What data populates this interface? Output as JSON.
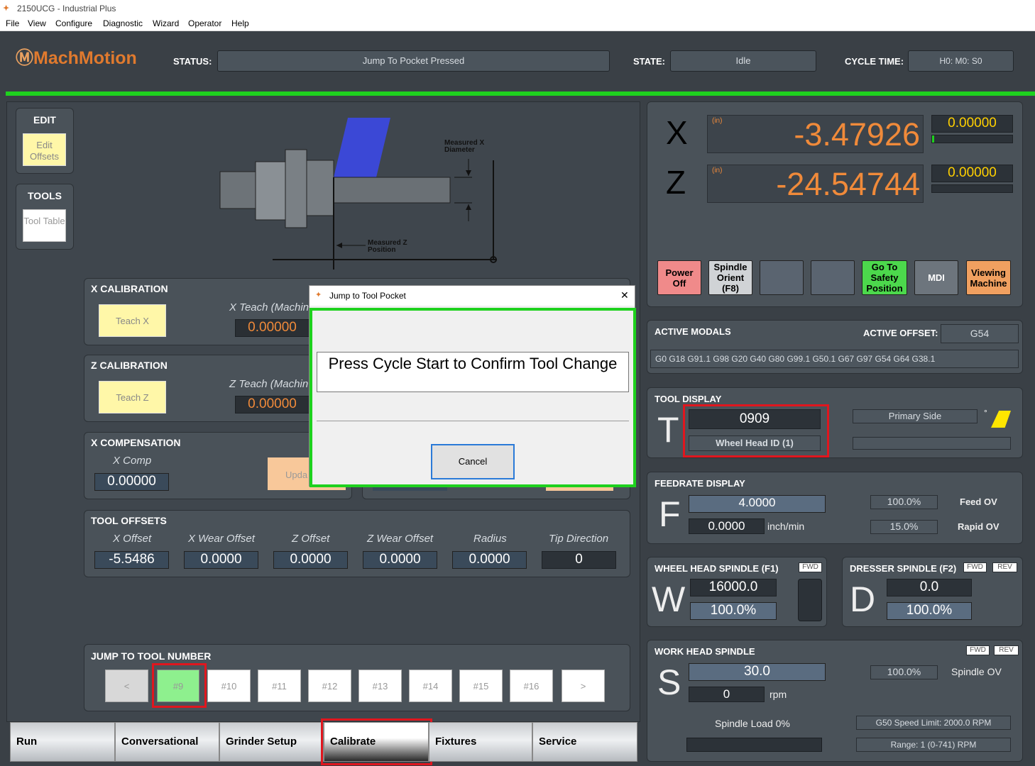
{
  "window": {
    "title": "2150UCG - Industrial Plus"
  },
  "menu": [
    "File",
    "View",
    "Configure",
    "Diagnostic",
    "Wizard",
    "Operator",
    "Help"
  ],
  "header": {
    "logo": "MachMotion",
    "status_label": "STATUS:",
    "status_value": "Jump To Pocket Pressed",
    "state_label": "STATE:",
    "state_value": "Idle",
    "cycle_label": "CYCLE TIME:",
    "cycle_value": "H0: M0: S0"
  },
  "edit": {
    "title": "EDIT",
    "button": "Edit Offsets"
  },
  "tools": {
    "title": "TOOLS",
    "button": "Tool Table"
  },
  "diagram": {
    "measured_x": "Measured X Diameter",
    "measured_z": "Measured Z Position"
  },
  "x_calibration": {
    "title": "X CALIBRATION",
    "teach_button": "Teach X",
    "teach_label": "X Teach (Machin",
    "value": "0.00000"
  },
  "z_calibration": {
    "title": "Z CALIBRATION",
    "teach_button": "Teach Z",
    "teach_label": "Z Teach (Machin",
    "value": "0.00000"
  },
  "x_compensation": {
    "title": "X COMPENSATION",
    "label": "X Comp",
    "value": "0.00000",
    "update_button": "Upda"
  },
  "tool_offsets": {
    "title": "TOOL OFFSETS",
    "columns": [
      "X Offset",
      "X Wear Offset",
      "Z Offset",
      "Z Wear Offset",
      "Radius",
      "Tip Direction"
    ],
    "values": [
      "-5.5486",
      "0.0000",
      "0.0000",
      "0.0000",
      "0.0000",
      "0"
    ]
  },
  "jump": {
    "title": "JUMP TO TOOL NUMBER",
    "buttons": [
      "<",
      "#9",
      "#10",
      "#11",
      "#12",
      "#13",
      "#14",
      "#15",
      "#16",
      ">"
    ]
  },
  "tabs": [
    "Run",
    "Conversational",
    "Grinder Setup",
    "Calibrate",
    "Fixtures",
    "Service"
  ],
  "dro": {
    "x_axis": "X",
    "x_unit": "(in)",
    "x_value": "-3.47926",
    "x_small": "0.00000",
    "z_axis": "Z",
    "z_unit": "(in)",
    "z_value": "-24.54744",
    "z_small": "0.00000"
  },
  "machine_buttons": [
    {
      "label": "Power Off",
      "color": "#f08a8a"
    },
    {
      "label": "Spindle Orient (F8)",
      "color": "#d0d3d6"
    },
    {
      "label": "",
      "color": "#5a6470"
    },
    {
      "label": "",
      "color": "#5a6470"
    },
    {
      "label": "Go To Safety Position",
      "color": "#4cd84c"
    },
    {
      "label": "MDI",
      "color": "#6d757d"
    },
    {
      "label": "Viewing Machine",
      "color": "#f0a060"
    }
  ],
  "modals": {
    "title": "ACTIVE MODALS",
    "offset_label": "ACTIVE OFFSET:",
    "offset_value": "G54",
    "codes": "G0 G18 G91.1 G98 G20 G40 G80 G99.1 G50.1 G67 G97 G54 G64 G38.1"
  },
  "tool_display": {
    "title": "TOOL DISPLAY",
    "letter": "T",
    "tool": "0909",
    "head": "Wheel Head ID (1)",
    "side": "Primary Side",
    "degree": "°"
  },
  "feedrate": {
    "title": "FEEDRATE DISPLAY",
    "letter": "F",
    "value": "4.0000",
    "rate": "0.0000",
    "unit": "inch/min",
    "feed_ov": "100.0%",
    "feed_ov_label": "Feed OV",
    "rapid_ov": "15.0%",
    "rapid_ov_label": "Rapid OV"
  },
  "wheel_spindle": {
    "title": "WHEEL HEAD SPINDLE (F1)",
    "fwd": "FWD",
    "letter": "W",
    "speed": "16000.0",
    "ov": "100.0%"
  },
  "dresser_spindle": {
    "title": "DRESSER SPINDLE (F2)",
    "fwd": "FWD",
    "rev": "REV",
    "letter": "D",
    "speed": "0.0",
    "ov": "100.0%"
  },
  "work_spindle": {
    "title": "WORK HEAD SPINDLE",
    "fwd": "FWD",
    "rev": "REV",
    "letter": "S",
    "speed": "30.0",
    "rpm": "0",
    "rpm_unit": "rpm",
    "ov": "100.0%",
    "ov_label": "Spindle OV",
    "load": "Spindle Load 0%",
    "limit": "G50 Speed Limit: 2000.0 RPM",
    "range": "Range: 1 (0-741) RPM"
  },
  "dialog": {
    "title": "Jump to Tool Pocket",
    "close": "✕",
    "message": "Press Cycle Start to Confirm Tool Change",
    "cancel": "Cancel"
  }
}
